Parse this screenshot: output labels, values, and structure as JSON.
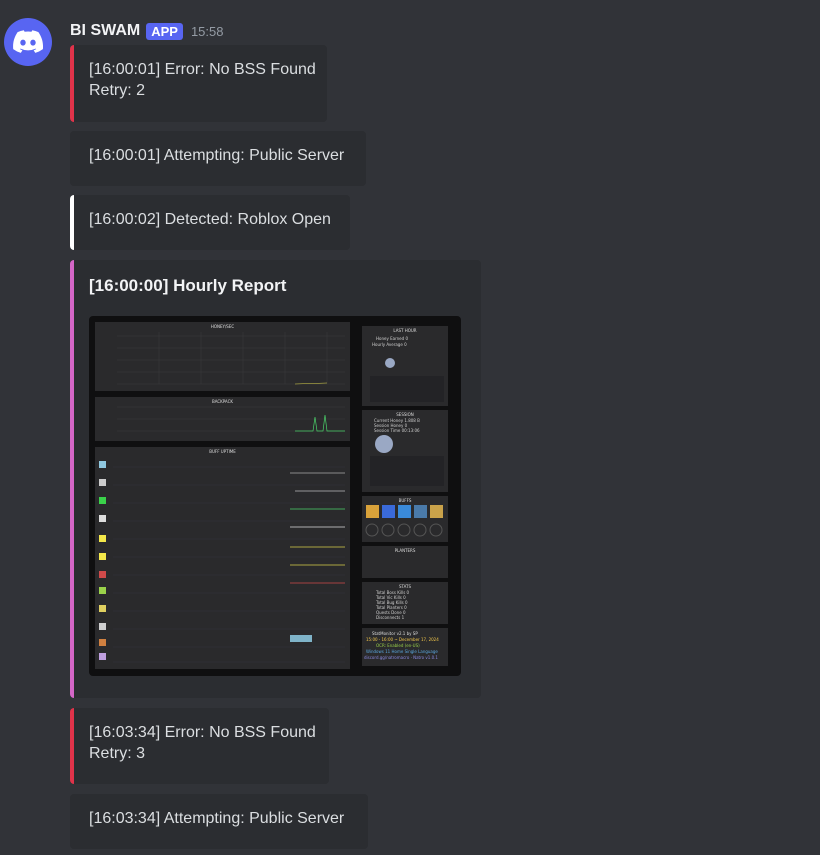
{
  "message": {
    "username": "BI SWAM",
    "badge": "APP",
    "timestamp": "15:58"
  },
  "embeds": [
    {
      "text": "[16:00:01] Error: No BSS Found\nRetry: 2",
      "color": "#e0334a"
    },
    {
      "text": "[16:00:01] Attempting: Public Server",
      "color": "#2b2d31"
    },
    {
      "text": "[16:00:02] Detected: Roblox Open",
      "color": "#ffffff"
    },
    {
      "title": "[16:00:00] Hourly Report",
      "color": "#d466c7"
    },
    {
      "text": "[16:03:34] Error: No BSS Found\nRetry: 3",
      "color": "#e0334a"
    },
    {
      "text": "[16:03:34] Attempting: Public Server",
      "color": "#2b2d31"
    }
  ],
  "report_image": {
    "honey_title": "HONEY/SEC",
    "backpack_title": "BACKPACK",
    "buff_title": "BUFF UPTIME",
    "last_hour_title": "LAST HOUR",
    "session_title": "SESSION",
    "buffs_title": "BUFFS",
    "planters_title": "PLANTERS",
    "stats_title": "STATS",
    "last_hour_lines": [
      "Honey Earned  0",
      "Hourly Average  0"
    ],
    "session_lines": [
      "Current Honey  1.808 B",
      "Session Honey  0",
      "Session Time  00:13:06"
    ],
    "stats_lines": [
      "Total Boss Kills  0",
      "Total Vic Kills  0",
      "Total Bug Kills  0",
      "Total Planters  0",
      "Quests Done  0",
      "Disconnects  1"
    ],
    "time_labels": [
      "15:00",
      "15:15",
      "15:30",
      "15:45",
      "16:00"
    ],
    "footer_lines": [
      "StatMonitor v2.1 by SP",
      "15:00 - 16:00 ~ December 17, 2024",
      "OCR: Enabled (en-US)",
      "Windows 11 Home Single Language",
      "discord.gg/natromacro · Natro v1.0.1"
    ]
  }
}
